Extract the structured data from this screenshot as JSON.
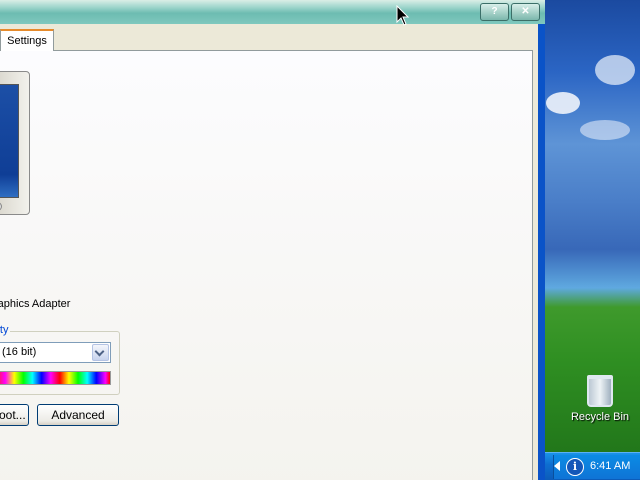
{
  "window": {
    "tabs": [
      {
        "label": "Settings",
        "active": true
      }
    ],
    "title_buttons": {
      "help": "?",
      "close": "✕"
    },
    "adapter_text": "raphics Adapter",
    "color_quality": {
      "label": "lity",
      "selected": "(16 bit)"
    },
    "buttons": {
      "troubleshoot": "oot...",
      "advanced": "Advanced"
    }
  },
  "desktop": {
    "recycle_bin_label": "Recycle Bin"
  },
  "taskbar": {
    "info_icon_glyph": "i",
    "clock": "6:41 AM"
  },
  "colors": {
    "titlebar": "#7fc8be",
    "tab_highlight": "#e68b2c",
    "group_label": "#0046d5",
    "taskbar": "#0e6fd1"
  }
}
